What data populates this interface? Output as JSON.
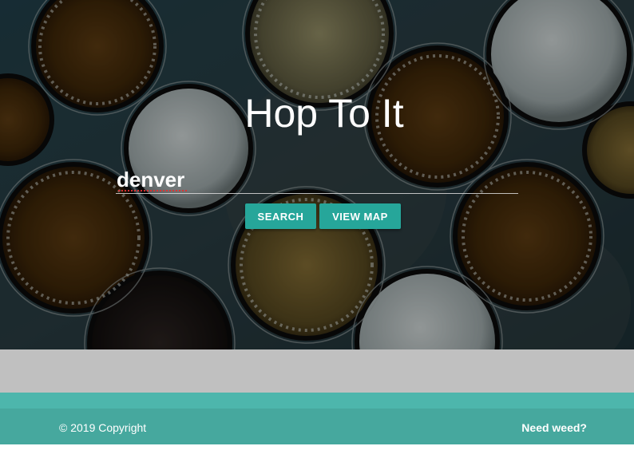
{
  "hero": {
    "title": "Hop To It",
    "search": {
      "value": "denver",
      "placeholder": ""
    },
    "buttons": {
      "search_label": "SEARCH",
      "map_label": "VIEW MAP"
    },
    "background_image": "beer-glasses-photo"
  },
  "footer": {
    "copyright": "© 2019 Copyright",
    "link_label": "Need weed?"
  },
  "colors": {
    "accent": "#26a69a",
    "footer": "#4db6ac",
    "gray_band": "#c0c0c0",
    "text_light": "#ffffff"
  }
}
